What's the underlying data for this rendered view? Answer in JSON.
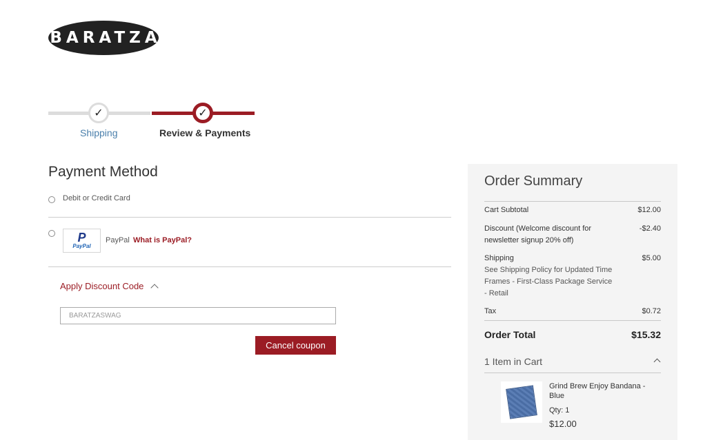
{
  "logo": {
    "text": "BARATZA"
  },
  "progress": {
    "steps": [
      {
        "label": "Shipping",
        "state": "complete"
      },
      {
        "label": "Review & Payments",
        "state": "active"
      }
    ],
    "check_glyph": "✓"
  },
  "payment": {
    "title": "Payment Method",
    "options": [
      {
        "label": "Debit or Credit Card"
      },
      {
        "label": "PayPal",
        "logo_text": "PayPal",
        "link": "What is PayPal?"
      }
    ],
    "discount": {
      "toggle_label": "Apply Discount Code",
      "code_value": "BARATZASWAG",
      "cancel_label": "Cancel coupon"
    }
  },
  "summary": {
    "title": "Order Summary",
    "rows": [
      {
        "label": "Cart Subtotal",
        "value": "$12.00"
      },
      {
        "label": "Discount (Welcome discount for newsletter signup 20% off)",
        "value": "-$2.40"
      },
      {
        "label": "Shipping",
        "sub": "See Shipping Policy for Updated Time Frames - First-Class Package Service - Retail",
        "value": "$5.00"
      },
      {
        "label": "Tax",
        "value": "$0.72"
      }
    ],
    "total_label": "Order Total",
    "total_value": "$15.32",
    "items_label": "1 Item in Cart",
    "item": {
      "name": "Grind Brew Enjoy Bandana - Blue",
      "qty": "Qty: 1",
      "price": "$12.00"
    }
  },
  "colors": {
    "accent": "#9b1c24",
    "link_blue": "#4a7fab",
    "summary_bg": "#f4f4f4"
  }
}
